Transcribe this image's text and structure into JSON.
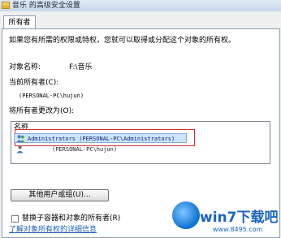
{
  "window": {
    "title": "音乐 的高级安全设置"
  },
  "tab": {
    "label": "所有者"
  },
  "intro_text": "如果您有所需的权限或特权，您就可以取得或分配这个对象的所有权。",
  "object_name": {
    "label": "对象名称:",
    "value": "F:\\音乐"
  },
  "current_owner": {
    "label": "当前所有者(C):",
    "value": "(PERSONAL-PC\\hujun)"
  },
  "change_owner": {
    "label": "将所有者更改为(O):",
    "column_header": "名称",
    "items": [
      {
        "icon": "group-users-icon",
        "text": "Administrators (PERSONAL-PC\\Administrators)",
        "selected": true
      },
      {
        "icon": "user-icon",
        "text": "(PERSONAL-PC\\hujun)",
        "selected": false
      }
    ]
  },
  "other_users_button": "其他用户或组(U)...",
  "replace_checkbox": {
    "label": "替换子容器和对象的所有者(R)",
    "checked": false
  },
  "help_link": "了解对象所有权的详细信息",
  "watermark": {
    "brand": "win7下载吧",
    "url": "www.8495.com"
  },
  "colors": {
    "highlight_border": "#d12c2c",
    "selection": "#cce4f7",
    "link": "#1a5fb4"
  }
}
